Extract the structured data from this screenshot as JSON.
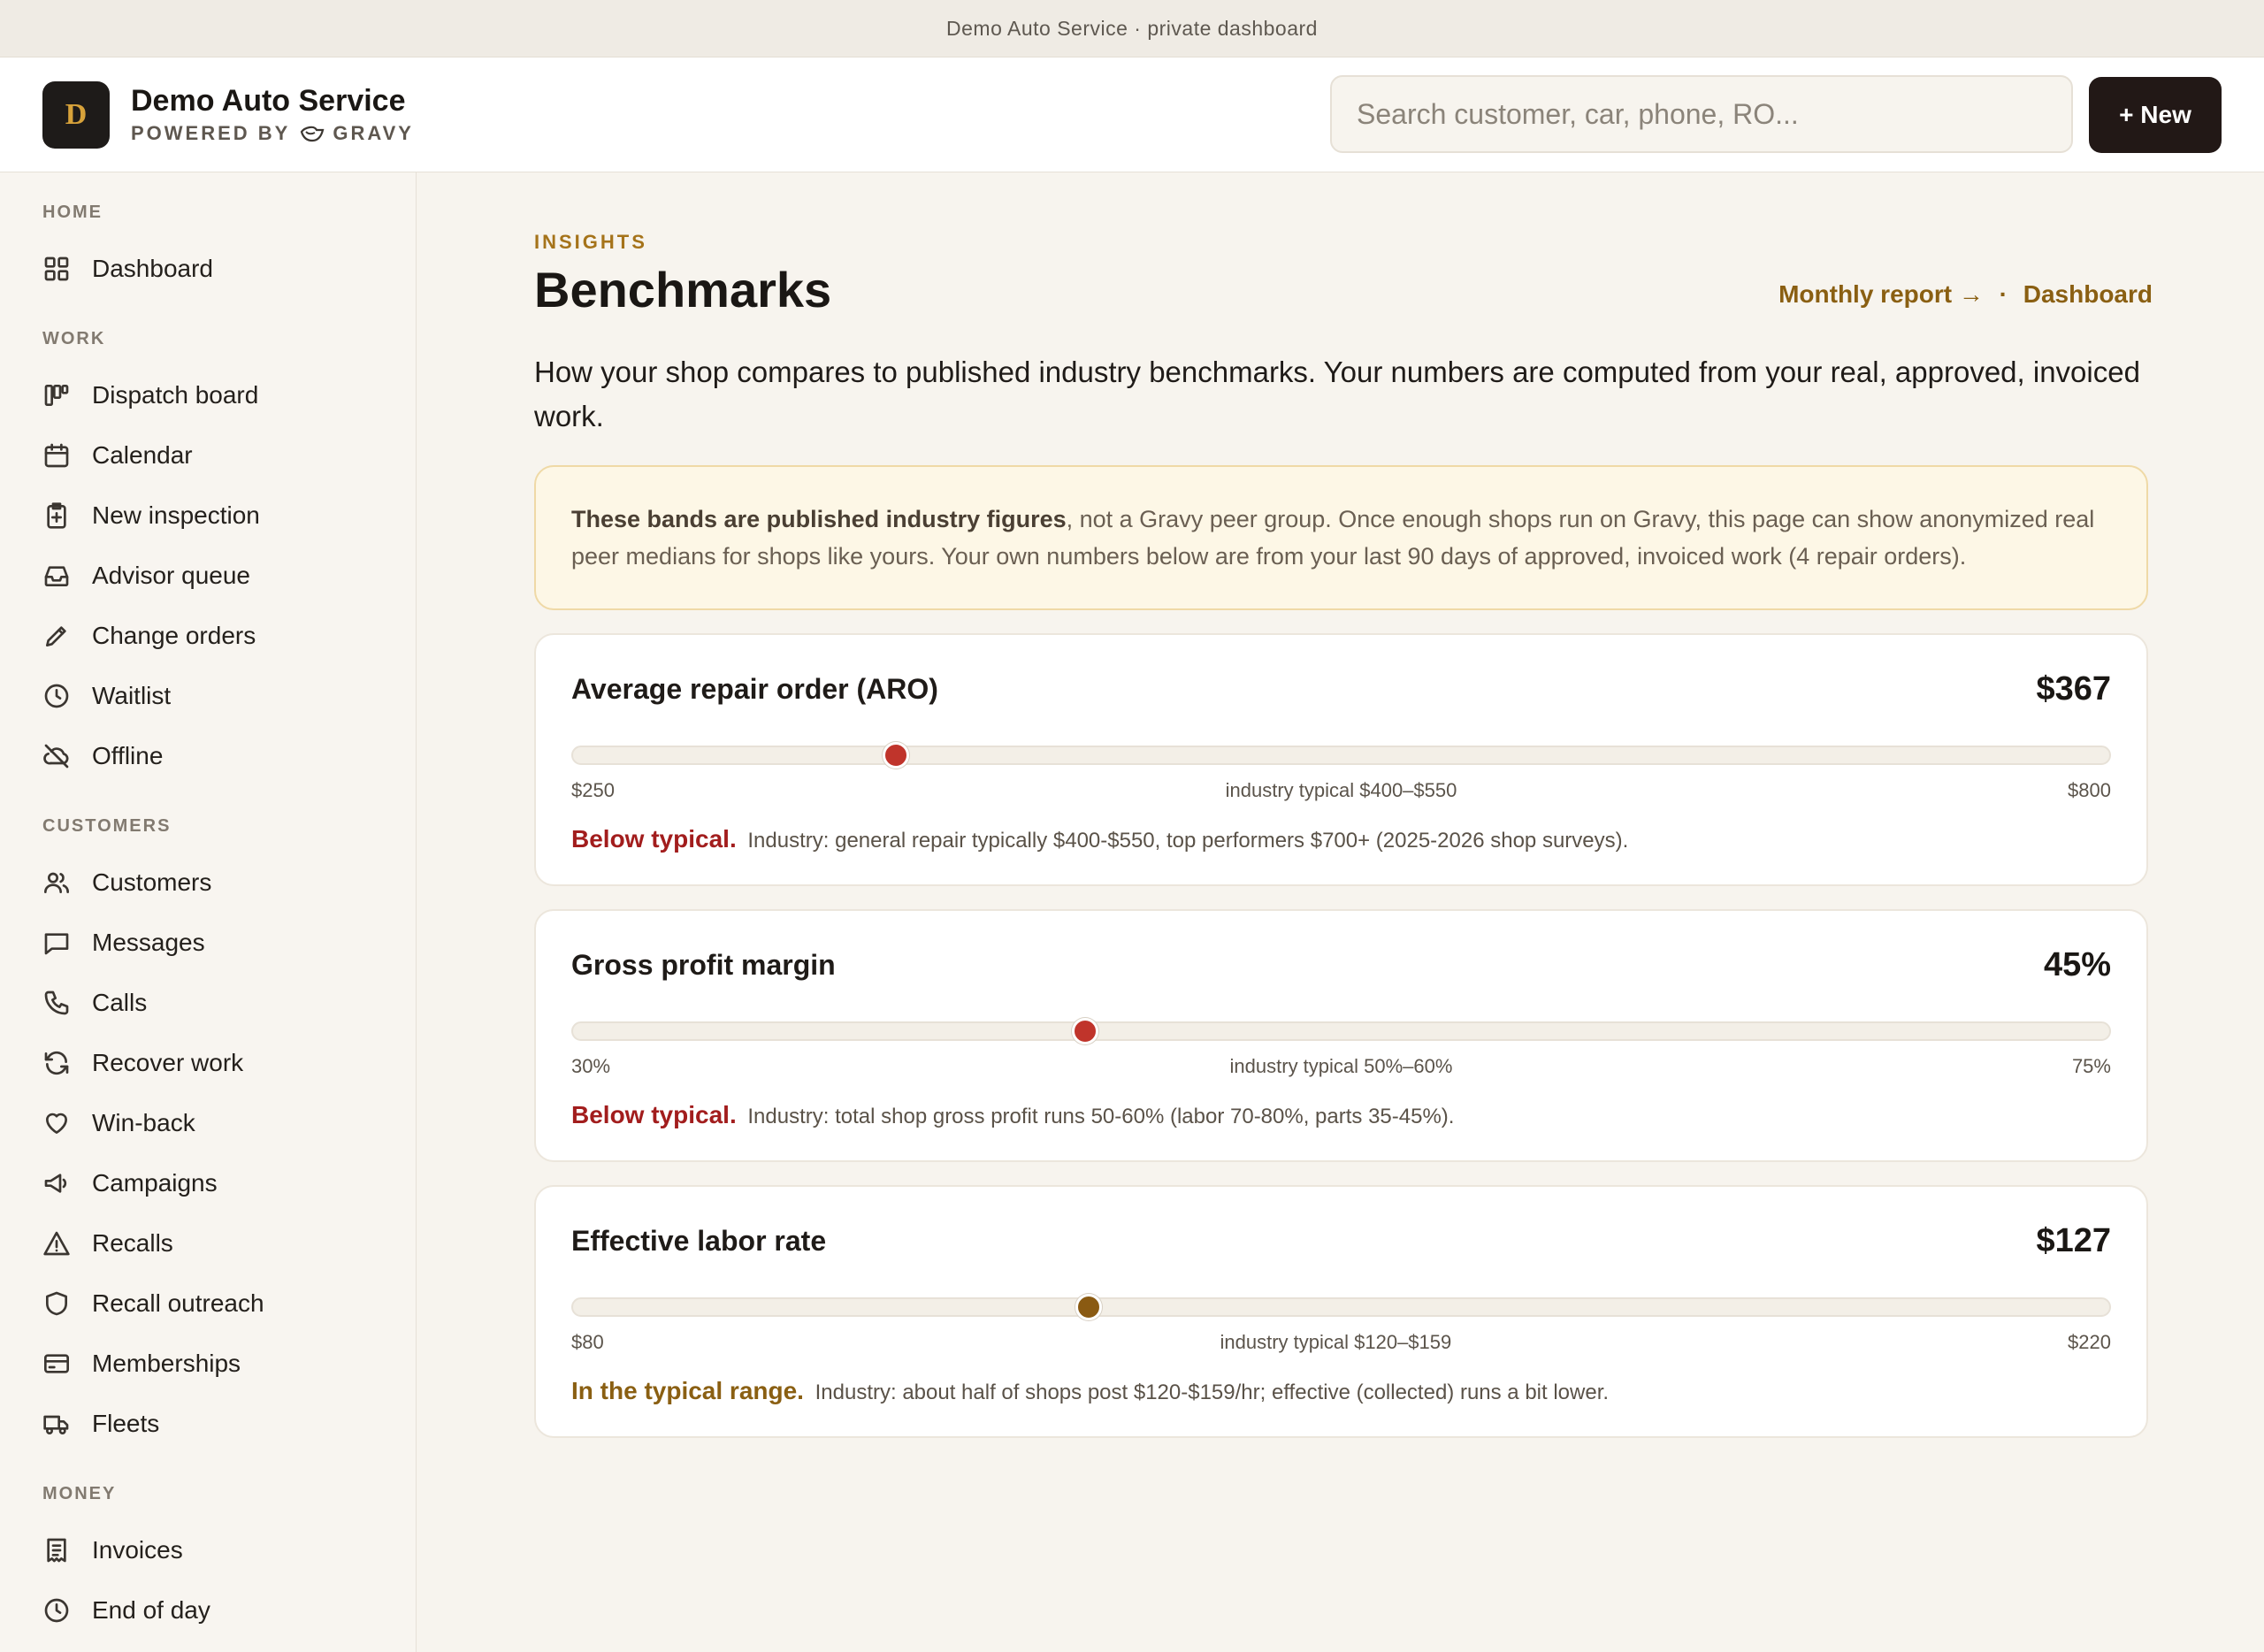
{
  "topbar": {
    "text": "Demo Auto Service · private dashboard"
  },
  "header": {
    "logo_letter": "D",
    "brand_name": "Demo Auto Service",
    "powered_by": "POWERED BY",
    "powered_brand": "GRAVY",
    "search_placeholder": "Search customer, car, phone, RO...",
    "new_label": "+ New"
  },
  "sidebar": {
    "sections": [
      {
        "title": "HOME",
        "items": [
          {
            "label": "Dashboard",
            "icon": "grid-icon"
          }
        ]
      },
      {
        "title": "WORK",
        "items": [
          {
            "label": "Dispatch board",
            "icon": "kanban-icon"
          },
          {
            "label": "Calendar",
            "icon": "calendar-icon"
          },
          {
            "label": "New inspection",
            "icon": "clipboard-plus-icon"
          },
          {
            "label": "Advisor queue",
            "icon": "inbox-icon"
          },
          {
            "label": "Change orders",
            "icon": "pencil-icon"
          },
          {
            "label": "Waitlist",
            "icon": "clock-icon"
          },
          {
            "label": "Offline",
            "icon": "cloud-off-icon"
          }
        ]
      },
      {
        "title": "CUSTOMERS",
        "items": [
          {
            "label": "Customers",
            "icon": "users-icon"
          },
          {
            "label": "Messages",
            "icon": "message-icon"
          },
          {
            "label": "Calls",
            "icon": "phone-icon"
          },
          {
            "label": "Recover work",
            "icon": "refresh-icon"
          },
          {
            "label": "Win-back",
            "icon": "heart-icon"
          },
          {
            "label": "Campaigns",
            "icon": "megaphone-icon"
          },
          {
            "label": "Recalls",
            "icon": "warning-icon"
          },
          {
            "label": "Recall outreach",
            "icon": "shield-icon"
          },
          {
            "label": "Memberships",
            "icon": "card-icon"
          },
          {
            "label": "Fleets",
            "icon": "truck-icon"
          }
        ]
      },
      {
        "title": "MONEY",
        "items": [
          {
            "label": "Invoices",
            "icon": "receipt-icon"
          },
          {
            "label": "End of day",
            "icon": "clock-icon"
          }
        ]
      }
    ]
  },
  "main": {
    "eyebrow": "INSIGHTS",
    "title": "Benchmarks",
    "link_monthly": "Monthly report →",
    "link_sep": "·",
    "link_dashboard": "Dashboard",
    "intro": "How your shop compares to published industry benchmarks. Your numbers are computed from your real, approved, invoiced work.",
    "notice_bold": "These bands are published industry figures",
    "notice_rest": ", not a Gravy peer group. Once enough shops run on Gravy, this page can show anonymized real peer medians for shops like yours. Your own numbers below are from your last 90 days of approved, invoiced work (4 repair orders).",
    "cards": [
      {
        "title": "Average repair order (ARO)",
        "value": "$367",
        "min_label": "$250",
        "band_label": "industry typical $400–$550",
        "max_label": "$800",
        "position": 0.21,
        "status": "below",
        "dot_color": "#c0342b",
        "verdict": "Below typical.",
        "detail": "Industry: general repair typically $400-$550, top performers $700+ (2025-2026 shop surveys)."
      },
      {
        "title": "Gross profit margin",
        "value": "45%",
        "min_label": "30%",
        "band_label": "industry typical 50%–60%",
        "max_label": "75%",
        "position": 0.3333,
        "status": "below",
        "dot_color": "#c0342b",
        "verdict": "Below typical.",
        "detail": "Industry: total shop gross profit runs 50-60% (labor 70-80%, parts 35-45%)."
      },
      {
        "title": "Effective labor rate",
        "value": "$127",
        "min_label": "$80",
        "band_label": "industry typical $120–$159",
        "max_label": "$220",
        "position": 0.3357,
        "status": "typical",
        "dot_color": "#8a5a12",
        "verdict": "In the typical range.",
        "detail": "Industry: about half of shops post $120-$159/hr; effective (collected) runs a bit lower."
      }
    ]
  }
}
